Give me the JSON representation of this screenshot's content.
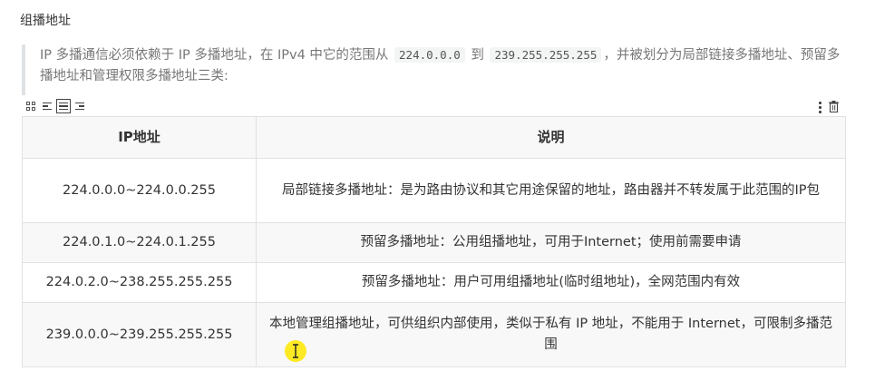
{
  "heading": "组播地址",
  "quote": {
    "text_before": "IP 多播通信必须依赖于 IP 多播地址，在 IPv4 中它的范围从",
    "code_start": "224.0.0.0",
    "text_mid": "到",
    "code_end": "239.255.255.255",
    "text_after": "，并被划分为局部链接多播地址、预留多播地址和管理权限多播地址三类:"
  },
  "toolbar": {
    "icons": [
      "grid-icon",
      "align-left-icon",
      "align-center-icon",
      "align-right-icon",
      "more-icon",
      "trash-icon"
    ]
  },
  "table": {
    "headers": [
      "IP地址",
      "说明"
    ],
    "rows": [
      [
        "224.0.0.0~224.0.0.255",
        "局部链接多播地址：是为路由协议和其它用途保留的地址，路由器并不转发属于此范围的IP包"
      ],
      [
        "224.0.1.0~224.0.1.255",
        "预留多播地址：公用组播地址，可用于Internet；使用前需要申请"
      ],
      [
        "224.0.2.0~238.255.255.255",
        "预留多播地址：用户可用组播地址(临时组地址)，全网范围内有效"
      ],
      [
        "239.0.0.0~239.255.255.255",
        "本地管理组播地址，可供组织内部使用，类似于私有 IP 地址，不能用于 Internet，可限制多播范围"
      ]
    ]
  },
  "cursor": {
    "icon": "text-cursor-icon",
    "highlight_color": "#ffe600"
  }
}
